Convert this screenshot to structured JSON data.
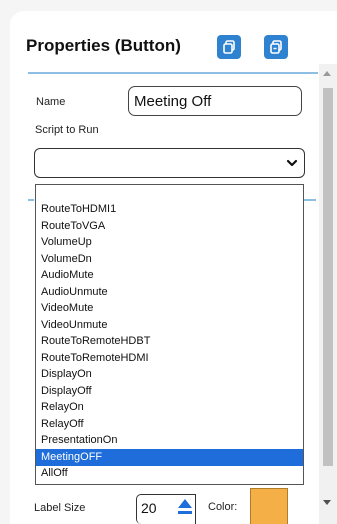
{
  "panel": {
    "title": "Properties (Button)",
    "copy_icon_1": "copy-icon",
    "copy_icon_2": "paste-icon"
  },
  "fields": {
    "name_label": "Name",
    "name_value": "Meeting Off",
    "script_label": "Script to Run",
    "script_value": ""
  },
  "dropdown": {
    "options": [
      "RouteToHDMI1",
      "RouteToVGA",
      "VolumeUp",
      "VolumeDn",
      "AudioMute",
      "AudioUnmute",
      "VideoMute",
      "VideoUnmute",
      "RouteToRemoteHDBT",
      "RouteToRemoteHDMI",
      "DisplayOn",
      "DisplayOff",
      "RelayOn",
      "RelayOff",
      "PresentationOn",
      "MeetingOFF",
      "AllOff"
    ],
    "selected": "MeetingOFF"
  },
  "bottom": {
    "label_size_label": "Label Size",
    "label_size_value": "20",
    "color_label": "Color:",
    "color_value": "#f4b046"
  },
  "colors": {
    "accent": "#2f82d0",
    "selected_bg": "#1e6ddb",
    "rule": "#8cbfe3"
  }
}
